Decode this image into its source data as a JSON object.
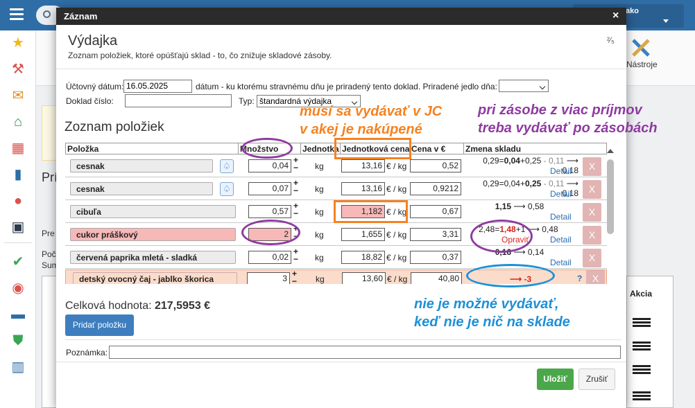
{
  "modal": {
    "title": "Záznam",
    "close": "×",
    "heading": "Výdajka",
    "subtitle": "Zoznam položiek, ktoré opúšťajú sklad - to, čo znižuje skladové zásoby.",
    "pager": "²⁄₅"
  },
  "form": {
    "date_label": "Účtovný dátum:",
    "date_value": "16.05.2025",
    "date_note": "dátum - ku ktorému stravnému dňu je priradený tento doklad. Priradené jedlo dňa:",
    "meal_value": "",
    "docnum_label": "Doklad číslo:",
    "docnum_value": "",
    "type_label": "Typ:",
    "type_value": "štandardná výdajka"
  },
  "items_heading": "Zoznam položiek",
  "columns": {
    "item": "Položka",
    "qty": "Množstvo",
    "unit": "Jednotka",
    "unit_price": "Jednotková cena",
    "price": "Cena v €",
    "change": "Zmena skladu"
  },
  "rows": [
    {
      "name": "cesnak",
      "qty": "0,04",
      "unit": "kg",
      "price": "13,16",
      "per": "€ / kg",
      "total": "0,52",
      "change_pre": "0,29=",
      "change_bold": "0,04",
      "change_post": "+0,25",
      "change_grey": " - 0,11",
      "change_end": " ⟶ 0,18",
      "detail": "Detail"
    },
    {
      "name": "cesnak",
      "qty": "0,07",
      "unit": "kg",
      "price": "13,16",
      "per": "€ / kg",
      "total": "0,9212",
      "change_pre": "0,29=0,04+",
      "change_bold": "0,25",
      "change_post": "",
      "change_grey": " - 0,11",
      "change_end": " ⟶ 0,18",
      "detail": "Detail"
    },
    {
      "name": "cibuľa",
      "qty": "0,57",
      "unit": "kg",
      "price": "1,182",
      "per": "€ / kg",
      "total": "0,67",
      "change_bold": "1,15",
      "change_end": " ⟶ 0,58",
      "detail": "Detail"
    },
    {
      "name": "cukor práškový",
      "qty": "2",
      "unit": "kg",
      "price": "1,655",
      "per": "€ / kg",
      "total": "3,31",
      "change_pre": "2,48=",
      "change_red": "1,48",
      "change_post": "+1 ⟶ 0,48",
      "fix": "Opraviť",
      "detail": "Detail"
    },
    {
      "name": "červená paprika mletá - sladká",
      "qty": "0,02",
      "unit": "kg",
      "price": "18,82",
      "per": "€ / kg",
      "total": "0,37",
      "change_bold": "0,16",
      "change_end": " ⟶ 0,14",
      "detail": "Detail"
    },
    {
      "name": "detský ovocný čaj - jablko škorica",
      "qty": "3",
      "unit": "kg",
      "price": "13,60",
      "per": "€ / kg",
      "total": "40,80",
      "change_neg": "⟶ -3",
      "question": "?"
    }
  ],
  "total_label": "Celková hodnota:",
  "total_value": "217,5953 €",
  "add_button": "Pridať položku",
  "note_label": "Poznámka:",
  "note_value": "",
  "save_button": "Uložiť",
  "cancel_button": "Zrušiť",
  "delete_symbol": "X",
  "annotations": {
    "jc_line1": "musí sa vydávať v JC",
    "jc_line2": "v akej je nakúpené",
    "stock_line1": "pri zásobe z viac príjmov",
    "stock_line2": "treba vydávať po zásobách",
    "empty_line1": "nie je možné vydávať,",
    "empty_line2": "keď nie je nič na sklade"
  },
  "background": {
    "user": "ako",
    "tools": "Nástroje",
    "pri": "Prí",
    "pre": "Pre",
    "poc": "Poč",
    "sum": "Sum",
    "akcia": "Akcia"
  },
  "colors": {
    "annotation_orange": "#f58220",
    "annotation_purple": "#8e3ba0",
    "annotation_blue": "#1e90d6",
    "highlight_pink": "#f7b8b8",
    "topbar": "#2f6da6"
  }
}
